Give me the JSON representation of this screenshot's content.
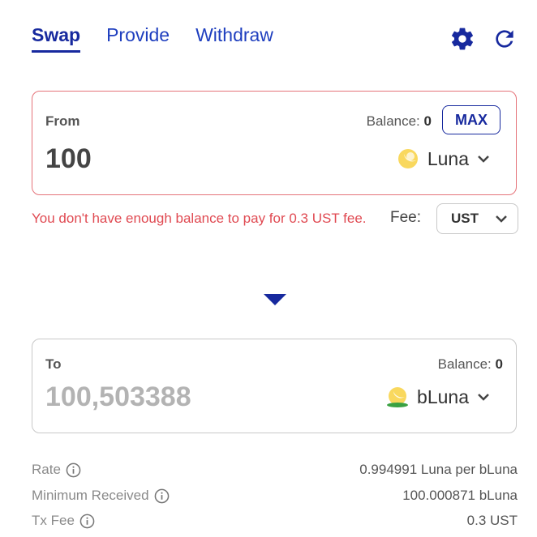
{
  "tabs": [
    {
      "label": "Swap",
      "active": true
    },
    {
      "label": "Provide",
      "active": false
    },
    {
      "label": "Withdraw",
      "active": false
    }
  ],
  "toolbar": {
    "settings_icon": "gear-icon",
    "refresh_icon": "refresh-icon"
  },
  "from": {
    "label": "From",
    "balance_label": "Balance:",
    "balance_value": "0",
    "max_label": "MAX",
    "amount": "100",
    "asset": "Luna"
  },
  "error": {
    "message": "You don't have enough balance to pay for 0.3 UST fee."
  },
  "fee": {
    "label": "Fee:",
    "selected": "UST"
  },
  "to": {
    "label": "To",
    "balance_label": "Balance:",
    "balance_value": "0",
    "amount": "100,503388",
    "asset": "bLuna"
  },
  "details": [
    {
      "label": "Rate",
      "value": "0.994991 Luna per bLuna"
    },
    {
      "label": "Minimum Received",
      "value": "100.000871 bLuna"
    },
    {
      "label": "Tx Fee",
      "value": "0.3 UST"
    }
  ],
  "colors": {
    "accent": "#17299e",
    "error": "#e04a52",
    "error_border": "#e57379"
  }
}
